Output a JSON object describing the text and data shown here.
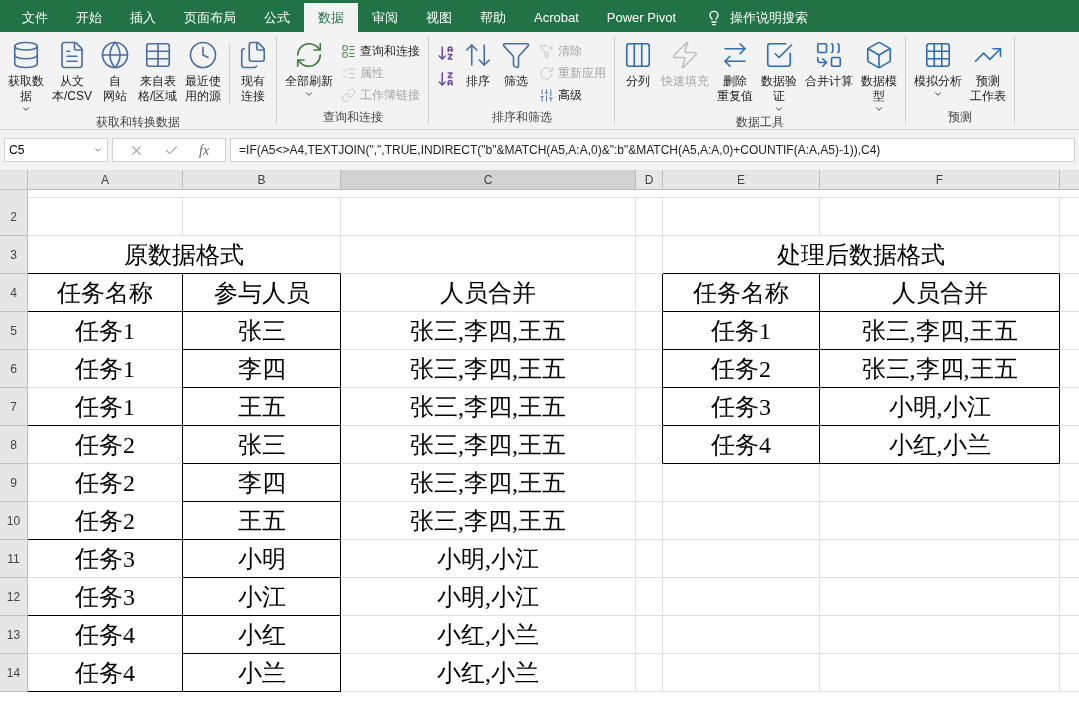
{
  "tabs": [
    {
      "label": "文件",
      "selected": false
    },
    {
      "label": "开始",
      "selected": false
    },
    {
      "label": "插入",
      "selected": false
    },
    {
      "label": "页面布局",
      "selected": false
    },
    {
      "label": "公式",
      "selected": false
    },
    {
      "label": "数据",
      "selected": true
    },
    {
      "label": "审阅",
      "selected": false
    },
    {
      "label": "视图",
      "selected": false
    },
    {
      "label": "帮助",
      "selected": false
    },
    {
      "label": "Acrobat",
      "selected": false
    },
    {
      "label": "Power Pivot",
      "selected": false
    }
  ],
  "tell_me": "操作说明搜索",
  "ribbon_groups": [
    {
      "label": "获取和转换数据",
      "buttons": [
        {
          "kind": "large",
          "lines": [
            "获取数",
            "据"
          ],
          "dropdown": true,
          "disabled": false
        },
        {
          "kind": "large",
          "lines": [
            "从文",
            "本/CSV"
          ],
          "dropdown": false,
          "disabled": false
        },
        {
          "kind": "large",
          "lines": [
            "自",
            "网站"
          ],
          "dropdown": false,
          "disabled": false
        },
        {
          "kind": "large",
          "lines": [
            "来自表",
            "格/区域"
          ],
          "dropdown": false,
          "disabled": false
        },
        {
          "kind": "large",
          "lines": [
            "最近使",
            "用的源"
          ],
          "dropdown": false,
          "disabled": false
        },
        {
          "kind": "separator"
        },
        {
          "kind": "large",
          "lines": [
            "现有",
            "连接"
          ],
          "dropdown": false,
          "disabled": false
        }
      ]
    },
    {
      "label": "查询和连接",
      "buttons": [
        {
          "kind": "large",
          "lines": [
            "全部刷新"
          ],
          "dropdown": true,
          "disabled": false
        },
        {
          "kind": "small",
          "lines": [
            "查询和连接"
          ],
          "disabled": false
        },
        {
          "kind": "small",
          "lines": [
            "属性"
          ],
          "disabled": true
        },
        {
          "kind": "small",
          "lines": [
            "工作簿链接"
          ],
          "disabled": true
        }
      ]
    },
    {
      "label": "排序和筛选",
      "buttons": [
        {
          "kind": "sort"
        },
        {
          "kind": "large",
          "lines": [
            "排序"
          ],
          "dropdown": false,
          "disabled": false
        },
        {
          "kind": "large",
          "lines": [
            "筛选"
          ],
          "dropdown": false,
          "disabled": false
        },
        {
          "kind": "small",
          "lines": [
            "清除"
          ],
          "disabled": true
        },
        {
          "kind": "small",
          "lines": [
            "重新应用"
          ],
          "disabled": true
        },
        {
          "kind": "small",
          "lines": [
            "高级"
          ],
          "disabled": false
        }
      ]
    },
    {
      "label": "数据工具",
      "buttons": [
        {
          "kind": "large",
          "lines": [
            "分列"
          ],
          "dropdown": false,
          "disabled": false
        },
        {
          "kind": "large",
          "lines": [
            "快速填充"
          ],
          "dropdown": false,
          "disabled": true
        },
        {
          "kind": "large",
          "lines": [
            "删除",
            "重复值"
          ],
          "dropdown": false,
          "disabled": false
        },
        {
          "kind": "large",
          "lines": [
            "数据验",
            "证"
          ],
          "dropdown": true,
          "disabled": false
        },
        {
          "kind": "large",
          "lines": [
            "合并计算"
          ],
          "dropdown": false,
          "disabled": false
        },
        {
          "kind": "large",
          "lines": [
            "数据模",
            "型"
          ],
          "dropdown": true,
          "disabled": false
        }
      ]
    },
    {
      "label": "预测",
      "buttons": [
        {
          "kind": "large",
          "lines": [
            "模拟分析"
          ],
          "dropdown": true,
          "disabled": false
        },
        {
          "kind": "large",
          "lines": [
            "预测",
            "工作表"
          ],
          "dropdown": false,
          "disabled": false
        }
      ]
    }
  ],
  "name_box": "C5",
  "function_label": "fx",
  "formula": "=IF(A5<>A4,TEXTJOIN(\",\",TRUE,INDIRECT(\"b\"&MATCH(A5,A:A,0)&\":b\"&MATCH(A5,A:A,0)+COUNTIF(A:A,A5)-1)),C4)",
  "columns": [
    "A",
    "B",
    "C",
    "D",
    "E",
    "F"
  ],
  "rows": [
    {
      "number": "2"
    },
    {
      "number": "3",
      "a_b": "原数据格式",
      "e_f": "处理后数据格式"
    },
    {
      "number": "4",
      "a": "任务名称",
      "b": "参与人员",
      "c": "人员合并",
      "e": "任务名称",
      "f": "人员合并"
    },
    {
      "number": "5",
      "a": "任务1",
      "b": "张三",
      "c": "张三,李四,王五",
      "e": "任务1",
      "f": "张三,李四,王五"
    },
    {
      "number": "6",
      "a": "任务1",
      "b": "李四",
      "c": "张三,李四,王五",
      "e": "任务2",
      "f": "张三,李四,王五"
    },
    {
      "number": "7",
      "a": "任务1",
      "b": "王五",
      "c": "张三,李四,王五",
      "e": "任务3",
      "f": "小明,小江"
    },
    {
      "number": "8",
      "a": "任务2",
      "b": "张三",
      "c": "张三,李四,王五",
      "e": "任务4",
      "f": "小红,小兰"
    },
    {
      "number": "9",
      "a": "任务2",
      "b": "李四",
      "c": "张三,李四,王五"
    },
    {
      "number": "10",
      "a": "任务2",
      "b": "王五",
      "c": "张三,李四,王五"
    },
    {
      "number": "11",
      "a": "任务3",
      "b": "小明",
      "c": "小明,小江"
    },
    {
      "number": "12",
      "a": "任务3",
      "b": "小江",
      "c": "小明,小江"
    },
    {
      "number": "13",
      "a": "任务4",
      "b": "小红",
      "c": "小红,小兰"
    },
    {
      "number": "14",
      "a": "任务4",
      "b": "小兰",
      "c": "小红,小兰"
    }
  ]
}
